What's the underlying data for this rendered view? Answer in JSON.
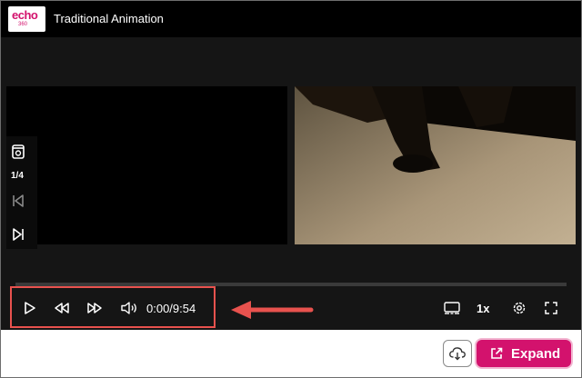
{
  "header": {
    "logo_text": "echo",
    "logo_subtext": "360",
    "title": "Traditional Animation"
  },
  "slides": {
    "counter": "1/4"
  },
  "controls": {
    "time": "0:00/9:54",
    "speed": "1x"
  },
  "actions": {
    "expand_label": "Expand"
  },
  "colors": {
    "accent": "#d3126d",
    "highlight": "#e8524e"
  },
  "icons": [
    "play-icon",
    "rewind-icon",
    "fast-forward-icon",
    "volume-icon",
    "captions-icon",
    "settings-icon",
    "fullscreen-icon",
    "download-cloud-icon",
    "external-link-icon",
    "slide-icon",
    "skip-back-icon",
    "skip-forward-icon"
  ]
}
